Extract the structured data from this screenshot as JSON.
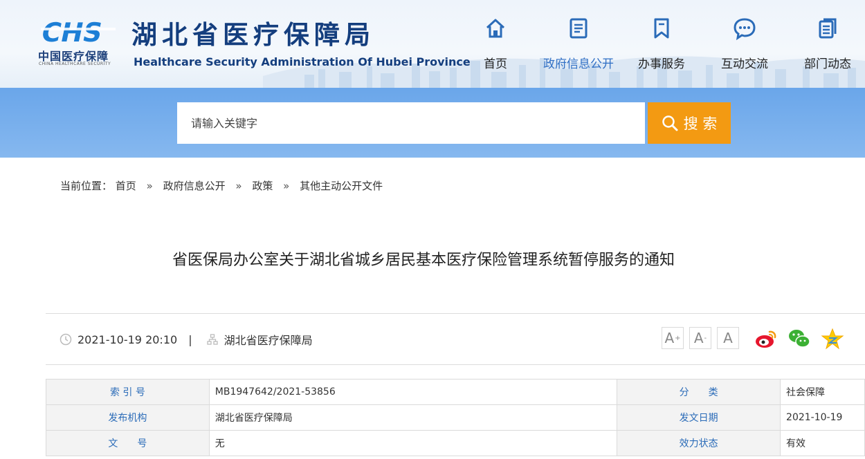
{
  "header": {
    "logo_letters": "CHS",
    "logo_cn": "中国医疗保障",
    "logo_en": "CHINA HEALTHCARE SECURITY",
    "title": "湖北省医疗保障局",
    "subtitle": "Healthcare Security Administration Of Hubei Province",
    "brand_color": "#143e7e",
    "accent_color": "#2f6fc5"
  },
  "nav": {
    "items": [
      {
        "label": "首页",
        "icon": "home-icon"
      },
      {
        "label": "政府信息公开",
        "icon": "document-list-icon",
        "active": true
      },
      {
        "label": "办事服务",
        "icon": "bookmark-icon"
      },
      {
        "label": "互动交流",
        "icon": "chat-bubble-icon"
      },
      {
        "label": "部门动态",
        "icon": "pages-icon"
      }
    ]
  },
  "search": {
    "placeholder": "请输入关键字",
    "button_label": "搜 索",
    "button_color": "#f39a12"
  },
  "breadcrumb": {
    "prefix": "当前位置：",
    "items": [
      "首页",
      "政府信息公开",
      "政策",
      "其他主动公开文件"
    ],
    "separator": "»"
  },
  "article": {
    "title": "省医保局办公室关于湖北省城乡居民基本医疗保险管理系统暂停服务的通知",
    "date": "2021-10-19 20:10",
    "meta_separator": "|",
    "source": "湖北省医疗保障局"
  },
  "font_controls": {
    "increase": "A",
    "increase_sup": "+",
    "decrease": "A",
    "decrease_sup": "-",
    "reset": "A"
  },
  "share": [
    "weibo-icon",
    "wechat-icon",
    "favorite-star-icon"
  ],
  "info_table": {
    "rows": [
      {
        "label1": "索 引 号",
        "value1": "MB1947642/2021-53856",
        "label2": "分　　类",
        "value2": "社会保障"
      },
      {
        "label1": "发布机构",
        "value1": "湖北省医疗保障局",
        "label2": "发文日期",
        "value2": "2021-10-19"
      },
      {
        "label1": "文　　号",
        "value1": "无",
        "label2": "效力状态",
        "value2": "有效"
      }
    ]
  }
}
